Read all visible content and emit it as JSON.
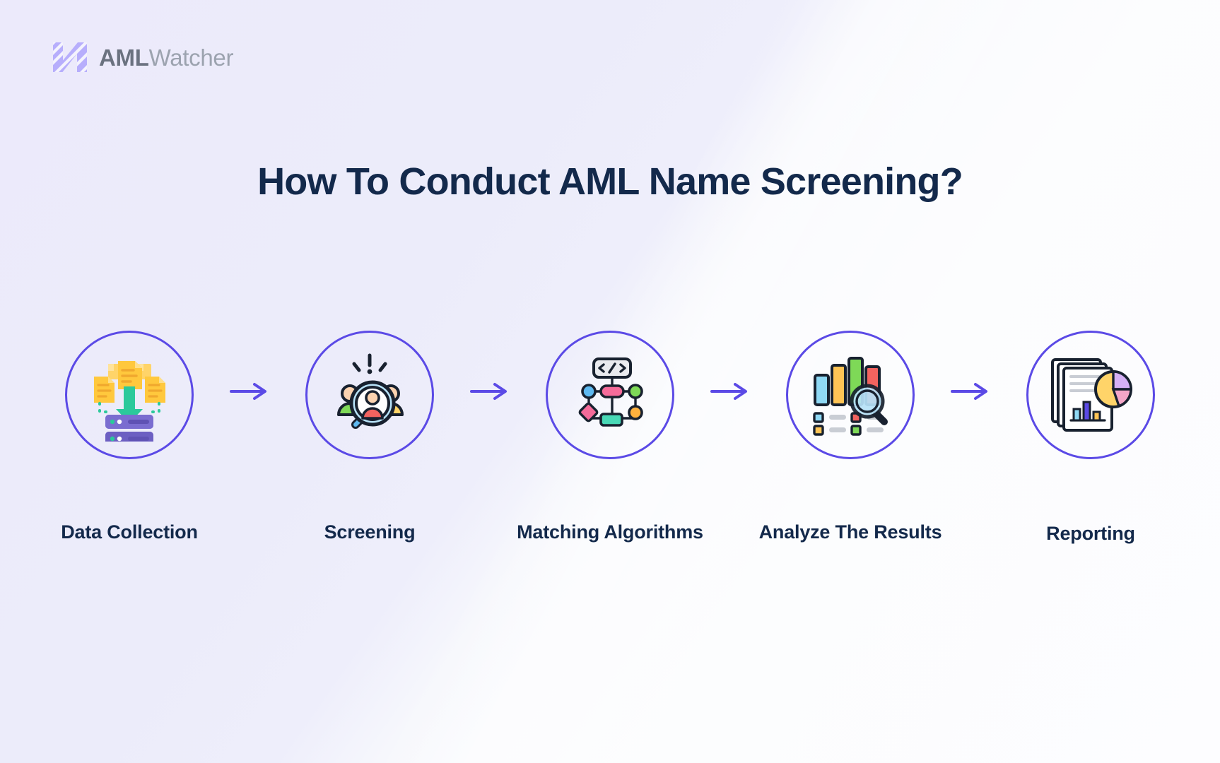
{
  "brand": {
    "logo_icon": "aml-watcher-logo-mark",
    "name_bold": "AML",
    "name_light": "Watcher",
    "accent_color": "#5b4ae6",
    "text_color": "#13294b"
  },
  "header": {
    "title": "How To Conduct AML Name Screening?"
  },
  "flow": {
    "arrow_icon": "arrow-right-icon",
    "steps": [
      {
        "label": "Data Collection",
        "icon": "data-collection-icon"
      },
      {
        "label": "Screening",
        "icon": "screening-magnifier-icon"
      },
      {
        "label": "Matching Algorithms",
        "icon": "matching-algorithms-flowchart-icon"
      },
      {
        "label": "Analyze The Results",
        "icon": "analyze-results-barchart-icon"
      },
      {
        "label": "Reporting",
        "icon": "reporting-documents-icon"
      }
    ]
  }
}
